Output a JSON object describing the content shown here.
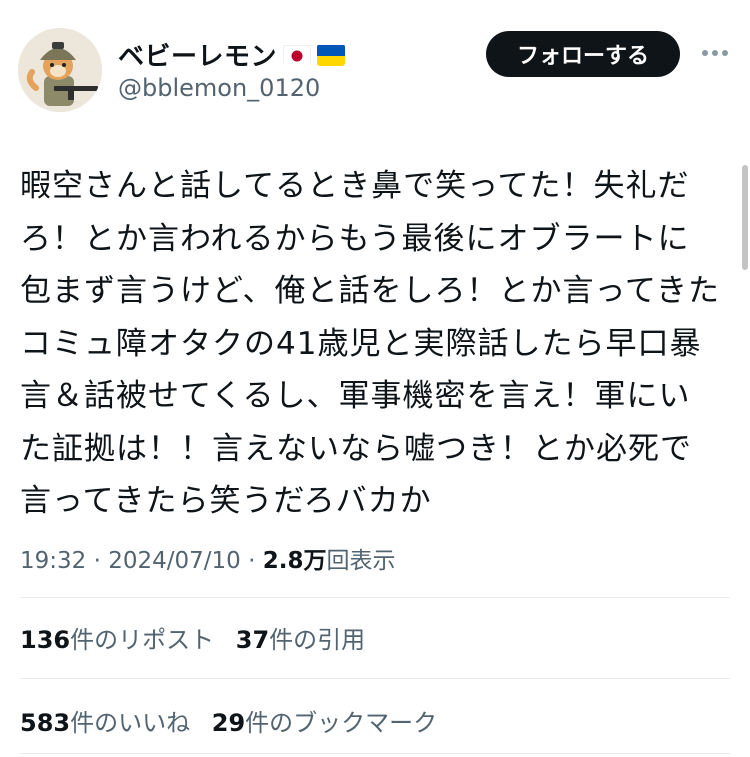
{
  "author": {
    "display_name": "ベビーレモン",
    "flags": [
      "japan-flag-icon",
      "ukraine-flag-icon"
    ],
    "handle": "@bblemon_0120"
  },
  "follow_button_label": "フォローする",
  "more_icon": "more-options-icon",
  "tweet": {
    "text": "暇空さんと話してるとき鼻で笑ってた！失礼だろ！とか言われるからもう最後にオブラートに包まず言うけど、俺と話をしろ！とか言ってきたコミュ障オタクの41歳児と実際話したら早口暴言＆話被せてくるし、軍事機密を言え！軍にいた証拠は！！言えないなら嘘つき！とか必死で言ってきたら笑うだろバカか"
  },
  "meta": {
    "time": "19:32",
    "sep1": " · ",
    "date": "2024/07/10",
    "sep2": " · ",
    "views_count": "2.8万",
    "views_label": "回表示"
  },
  "stats_row1": [
    {
      "count": "136",
      "label": "件のリポスト"
    },
    {
      "count": "37",
      "label": "件の引用"
    }
  ],
  "stats_row2": [
    {
      "count": "583",
      "label": "件のいいね"
    },
    {
      "count": "29",
      "label": "件のブックマーク"
    }
  ],
  "colors": {
    "text": "#0f1419",
    "secondary": "#536471",
    "button_bg": "#0f1419",
    "divider": "#e6ecf0"
  }
}
